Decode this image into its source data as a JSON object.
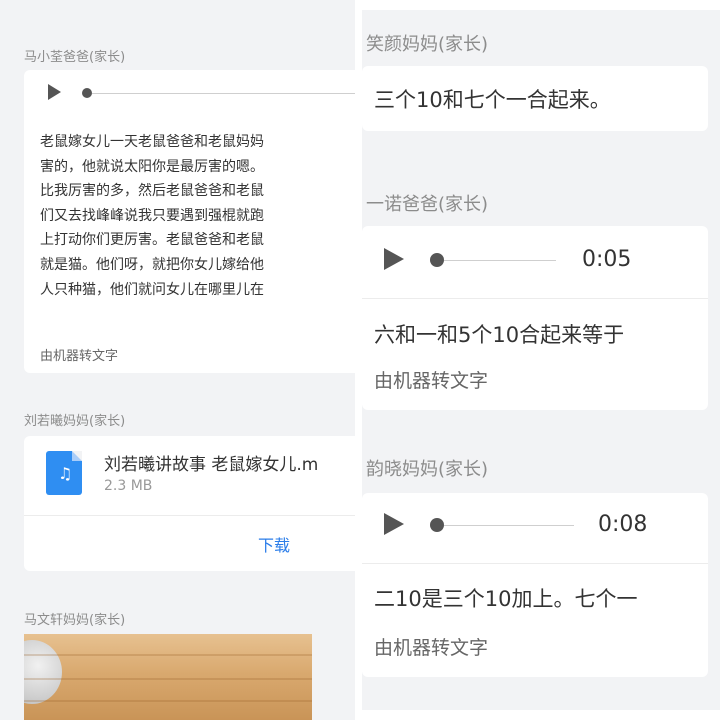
{
  "left_panel": {
    "post1": {
      "author": "马小荃爸爸(家长)",
      "text": "老鼠嫁女儿一天老鼠爸爸和老鼠妈妈\n害的，他就说太阳你是最厉害的嗯。\n比我厉害的多，然后老鼠爸爸和老鼠\n们又去找峰峰说我只要遇到强棍就跑\n上打动你们更厉害。老鼠爸爸和老鼠\n就是猫。他们呀，就把你女儿嫁给他\n人只种猫，他们就问女儿在哪里儿在",
      "machine_label": "由机器转文字"
    },
    "post2": {
      "author": "刘若曦妈妈(家长)",
      "file_name": "刘若曦讲故事 老鼠嫁女儿.m",
      "file_size": "2.3 MB",
      "download_label": "下载"
    },
    "post3": {
      "author": "马文轩妈妈(家长)"
    }
  },
  "right_panel": {
    "post1": {
      "author": "笑颜妈妈(家长)",
      "text": "三个10和七个一合起来。"
    },
    "post2": {
      "author": "一诺爸爸(家长)",
      "duration": "0:05",
      "text": "六和一和5个10合起来等于",
      "machine_label": "由机器转文字"
    },
    "post3": {
      "author": "韵晓妈妈(家长)",
      "duration": "0:08",
      "text": "二10是三个10加上。七个一",
      "machine_label": "由机器转文字"
    }
  },
  "icons": {
    "play": "play-icon",
    "progress_knob": "progress-knob-icon",
    "audio_file": "music-file-icon"
  },
  "colors": {
    "background": "#f2f3f5",
    "card": "#ffffff",
    "link": "#2b7de9",
    "file_icon": "#2f8ef2",
    "secondary_text": "#8c8c8c"
  }
}
